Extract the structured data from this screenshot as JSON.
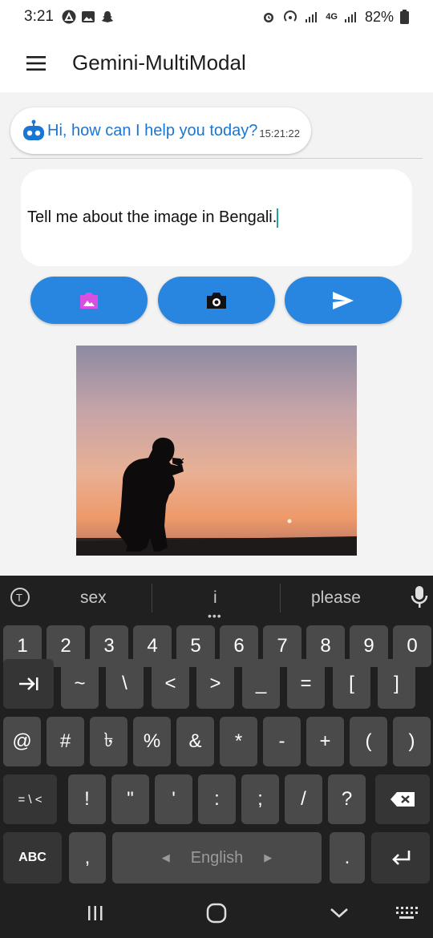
{
  "status_bar": {
    "time": "3:21",
    "network_label": "4G",
    "battery": "82%"
  },
  "app_bar": {
    "title": "Gemini-MultiModal",
    "menu_icon": "hamburger-menu-icon"
  },
  "chat": {
    "bot_message": "Hi, how can I help you today?",
    "bot_timestamp": "15:21:22",
    "bot_icon": "robot-icon"
  },
  "input": {
    "value": "Tell me about the image in Bengali."
  },
  "actions": {
    "gallery_icon": "gallery-image-icon",
    "camera_icon": "camera-icon",
    "send_icon": "send-icon",
    "accent_color": "#2986e0"
  },
  "keyboard": {
    "suggestions": [
      "sex",
      "i",
      "please"
    ],
    "number_row": [
      "1",
      "2",
      "3",
      "4",
      "5",
      "6",
      "7",
      "8",
      "9",
      "0"
    ],
    "row2": [
      "~",
      "\\",
      "<",
      ">",
      "_",
      "=",
      "[",
      "]"
    ],
    "row3": [
      "@",
      "#",
      "৳",
      "%",
      "&",
      "*",
      "-",
      "+",
      "(",
      ")"
    ],
    "row4_toggle": "= \\ <",
    "row4": [
      "!",
      "\"",
      "'",
      ":",
      ";",
      "/",
      "?"
    ],
    "abc_label": "ABC",
    "comma": ",",
    "space_label": "English",
    "period": "."
  }
}
